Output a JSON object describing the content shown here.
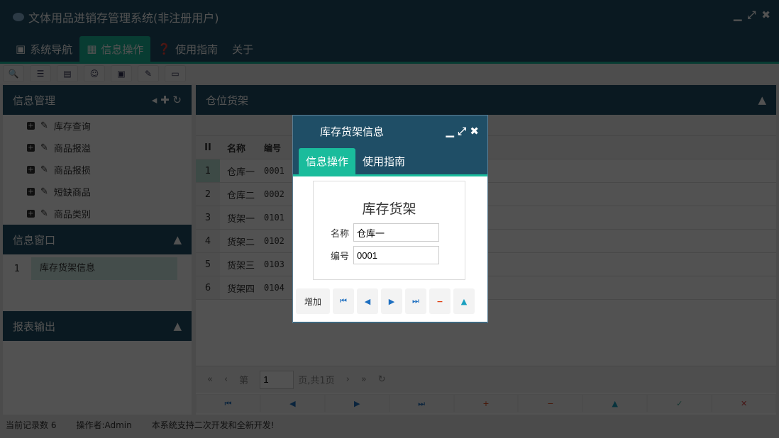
{
  "app": {
    "title": "文体用品进销存管理系统(非注册用户)",
    "controls": [
      "▁",
      "⤢",
      "✖"
    ]
  },
  "tabs": [
    {
      "label": "系统导航",
      "icon": "monitor-icon"
    },
    {
      "label": "信息操作",
      "icon": "grid-icon"
    },
    {
      "label": "使用指南",
      "icon": "help-icon"
    },
    {
      "label": "关于"
    }
  ],
  "toolbar": [
    "search-icon",
    "list-icon",
    "document-icon",
    "user-icon",
    "window-icon",
    "edit-icon",
    "form-icon"
  ],
  "left": {
    "title": "信息管理",
    "tree": [
      "库存查询",
      "商品报溢",
      "商品报损",
      "短缺商品",
      "商品类别"
    ],
    "window_title": "信息窗口",
    "windows": [
      {
        "index": "1",
        "label": "库存货架信息"
      }
    ],
    "report_title": "报表输出"
  },
  "right": {
    "title": "仓位货架",
    "headers": [
      "II",
      "名称",
      "编号"
    ],
    "rows": [
      [
        "1",
        "仓库一",
        "0001"
      ],
      [
        "2",
        "仓库二",
        "0002"
      ],
      [
        "3",
        "货架一",
        "0101"
      ],
      [
        "4",
        "货架二",
        "0102"
      ],
      [
        "5",
        "货架三",
        "0103"
      ],
      [
        "6",
        "货架四",
        "0104"
      ]
    ],
    "pager": {
      "first": "«",
      "prev": "‹",
      "page_prefix": "第",
      "page": "1",
      "page_suffix": "页,共1页",
      "next": "›",
      "last": "»",
      "refresh": "↻"
    },
    "nav": [
      "⏮",
      "◀",
      "▶",
      "⏭",
      "+",
      "−",
      "▲",
      "✓",
      "✕"
    ]
  },
  "dialog": {
    "title": "库存货架信息",
    "tabs": [
      "信息操作",
      "使用指南"
    ],
    "form_title": "库存货架",
    "fields": [
      {
        "label": "名称",
        "value": "仓库一"
      },
      {
        "label": "编号",
        "value": "0001"
      }
    ],
    "add": "增加",
    "buttons": [
      "⏮",
      "◀",
      "▶",
      "⏭",
      "−",
      "▲"
    ]
  },
  "status": [
    "当前记录数 6",
    "操作者:Admin",
    "本系统支持二次开发和全新开发!"
  ]
}
